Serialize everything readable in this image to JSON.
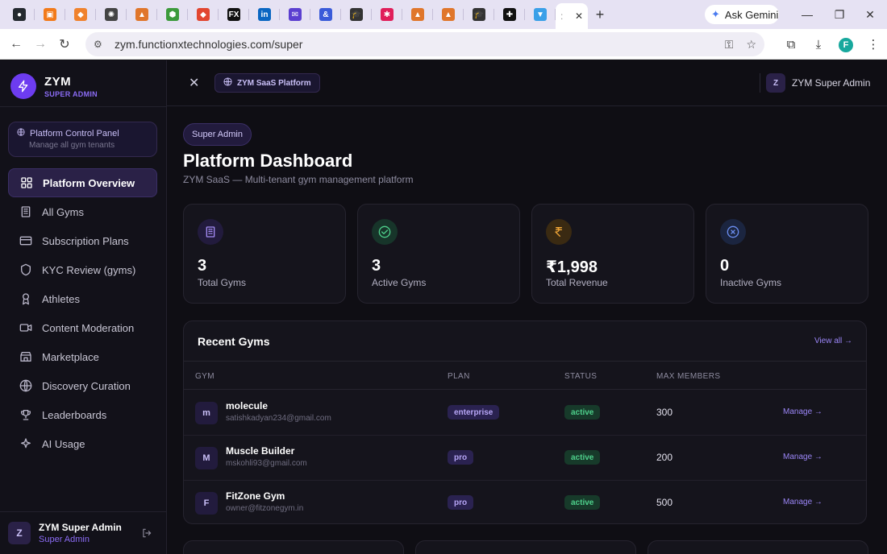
{
  "browser": {
    "tab_icons": [
      {
        "name": "github-icon",
        "color": "#24292f",
        "glyph": "●"
      },
      {
        "name": "orange-app-icon",
        "color": "#f27a1a",
        "glyph": "▣"
      },
      {
        "name": "cube-icon",
        "color": "#f0822d",
        "glyph": "◆"
      },
      {
        "name": "openai-icon",
        "color": "#444444",
        "glyph": "✺"
      },
      {
        "name": "ama-icon",
        "color": "#e0762b",
        "glyph": "▲"
      },
      {
        "name": "node-icon",
        "color": "#3c9a3c",
        "glyph": "⬢"
      },
      {
        "name": "git-icon",
        "color": "#e2452f",
        "glyph": "◆"
      },
      {
        "name": "fx-icon",
        "color": "#111111",
        "glyph": "FX"
      },
      {
        "name": "linkedin-icon",
        "color": "#0a66c2",
        "glyph": "in"
      },
      {
        "name": "mail-icon",
        "color": "#5b3fd0",
        "glyph": "✉"
      },
      {
        "name": "ampersand-icon",
        "color": "#3a5bd9",
        "glyph": "&"
      },
      {
        "name": "graduation-icon",
        "color": "#333333",
        "glyph": "🎓"
      },
      {
        "name": "slack-icon",
        "color": "#e01e5a",
        "glyph": "✱"
      },
      {
        "name": "ama-icon-2",
        "color": "#e0762b",
        "glyph": "▲"
      },
      {
        "name": "ama-icon-3",
        "color": "#e0762b",
        "glyph": "▲"
      },
      {
        "name": "graduation-icon-2",
        "color": "#333333",
        "glyph": "🎓"
      },
      {
        "name": "plus-app-icon",
        "color": "#111111",
        "glyph": "✚"
      },
      {
        "name": "vercel-icon",
        "color": "#3aa0e8",
        "glyph": "▼"
      }
    ],
    "active_tab_label": "",
    "ask_gemini": "Ask Gemini",
    "url": "zym.functionxtechnologies.com/super",
    "profile_initial": "F"
  },
  "brand": {
    "name": "ZYM",
    "subtitle": "SUPER ADMIN"
  },
  "control_panel": {
    "title": "Platform Control Panel",
    "subtitle": "Manage all gym tenants"
  },
  "nav": [
    {
      "label": "Platform Overview",
      "icon": "grid-icon",
      "active": true
    },
    {
      "label": "All Gyms",
      "icon": "building-icon",
      "active": false
    },
    {
      "label": "Subscription Plans",
      "icon": "card-icon",
      "active": false
    },
    {
      "label": "KYC Review (gyms)",
      "icon": "shield-icon",
      "active": false
    },
    {
      "label": "Athletes",
      "icon": "medal-icon",
      "active": false
    },
    {
      "label": "Content Moderation",
      "icon": "video-icon",
      "active": false
    },
    {
      "label": "Marketplace",
      "icon": "store-icon",
      "active": false
    },
    {
      "label": "Discovery Curation",
      "icon": "globe-icon",
      "active": false
    },
    {
      "label": "Leaderboards",
      "icon": "trophy-icon",
      "active": false
    },
    {
      "label": "AI Usage",
      "icon": "sparkle-icon",
      "active": false
    }
  ],
  "footer_user": {
    "initial": "Z",
    "name": "ZYM Super Admin",
    "role": "Super Admin"
  },
  "topbar": {
    "platform_label": "ZYM SaaS Platform",
    "user_initial": "Z",
    "user_name": "ZYM Super Admin"
  },
  "page": {
    "badge": "Super Admin",
    "title": "Platform Dashboard",
    "subtitle": "ZYM SaaS — Multi-tenant gym management platform"
  },
  "stats": [
    {
      "value": "3",
      "label": "Total Gyms",
      "icon": "building-icon",
      "icon_bg": "#221b3d",
      "icon_color": "#a58cf7"
    },
    {
      "value": "3",
      "label": "Active Gyms",
      "icon": "check-circle-icon",
      "icon_bg": "#17352a",
      "icon_color": "#4ed08b"
    },
    {
      "value": "₹1,998",
      "label": "Total Revenue",
      "icon": "rupee-icon",
      "icon_bg": "#3a2a12",
      "icon_color": "#f3a838"
    },
    {
      "value": "0",
      "label": "Inactive Gyms",
      "icon": "x-circle-icon",
      "icon_bg": "#1b2540",
      "icon_color": "#6b8ef0"
    }
  ],
  "recent_gyms": {
    "title": "Recent Gyms",
    "view_all": "View all →",
    "columns": [
      "GYM",
      "PLAN",
      "STATUS",
      "MAX MEMBERS"
    ],
    "rows": [
      {
        "initial": "m",
        "name": "molecule",
        "email": "satishkadyan234@gmail.com",
        "plan": "enterprise",
        "status": "active",
        "max_members": "300",
        "action": "Manage →"
      },
      {
        "initial": "M",
        "name": "Muscle Builder",
        "email": "mskohli93@gmail.com",
        "plan": "pro",
        "status": "active",
        "max_members": "200",
        "action": "Manage →"
      },
      {
        "initial": "F",
        "name": "FitZone Gym",
        "email": "owner@fitzonegym.in",
        "plan": "pro",
        "status": "active",
        "max_members": "500",
        "action": "Manage →"
      }
    ]
  },
  "colors": {
    "accent": "#6d3cf0",
    "accent_text": "#9b86f7",
    "status_active": "#4ed08b",
    "background": "#0f0e14"
  }
}
